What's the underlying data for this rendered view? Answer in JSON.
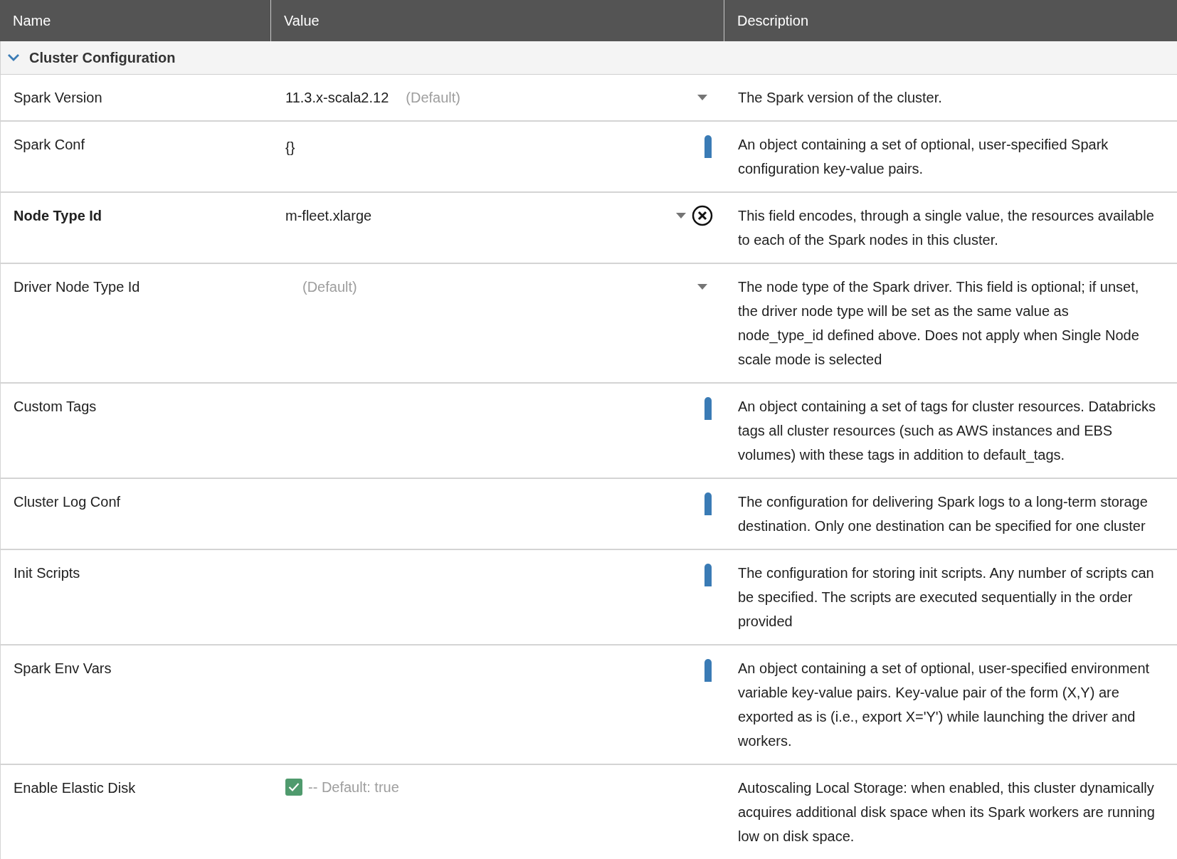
{
  "table": {
    "columns": [
      "Name",
      "Value",
      "Description"
    ],
    "group": {
      "title": "Cluster Configuration",
      "expanded": true
    },
    "rows": [
      {
        "name": "Spark Version",
        "required": false,
        "kind": "select",
        "value": "11.3.x-scala2.12",
        "hint": "(Default)",
        "description": "The Spark version of the cluster."
      },
      {
        "name": "Spark Conf",
        "required": false,
        "kind": "object",
        "value": "{}",
        "description": "An object containing a set of optional, user-specified Spark configuration key-value pairs."
      },
      {
        "name": "Node Type Id",
        "required": true,
        "kind": "select",
        "value": "m-fleet.xlarge",
        "clearable": true,
        "description": "This field encodes, through a single value, the resources available to each of the Spark nodes in this cluster."
      },
      {
        "name": "Driver Node Type Id",
        "required": false,
        "kind": "select",
        "hint": "(Default)",
        "description": "The node type of the Spark driver. This field is optional; if unset, the driver node type will be set as the same value as node_type_id defined above. Does not apply when Single Node scale mode is selected"
      },
      {
        "name": "Custom Tags",
        "required": false,
        "kind": "object",
        "description": "An object containing a set of tags for cluster resources. Databricks tags all cluster resources (such as AWS instances and EBS volumes) with these tags in addition to default_tags."
      },
      {
        "name": "Cluster Log Conf",
        "required": false,
        "kind": "object",
        "description": "The configuration for delivering Spark logs to a long-term storage destination. Only one destination can be specified for one cluster"
      },
      {
        "name": "Init Scripts",
        "required": false,
        "kind": "object",
        "description": "The configuration for storing init scripts. Any number of scripts can be specified. The scripts are executed sequentially in the order provided"
      },
      {
        "name": "Spark Env Vars",
        "required": false,
        "kind": "object",
        "description": "An object containing a set of optional, user-specified environment variable key-value pairs. Key-value pair of the form (X,Y) are exported as is (i.e., export X='Y') while launching the driver and workers."
      },
      {
        "name": "Enable Elastic Disk",
        "required": false,
        "kind": "checkbox",
        "checked": true,
        "hint": "-- Default: true",
        "description": "Autoscaling Local Storage: when enabled, this cluster dynamically acquires additional disk space when its Spark workers are running low on disk space."
      }
    ]
  }
}
